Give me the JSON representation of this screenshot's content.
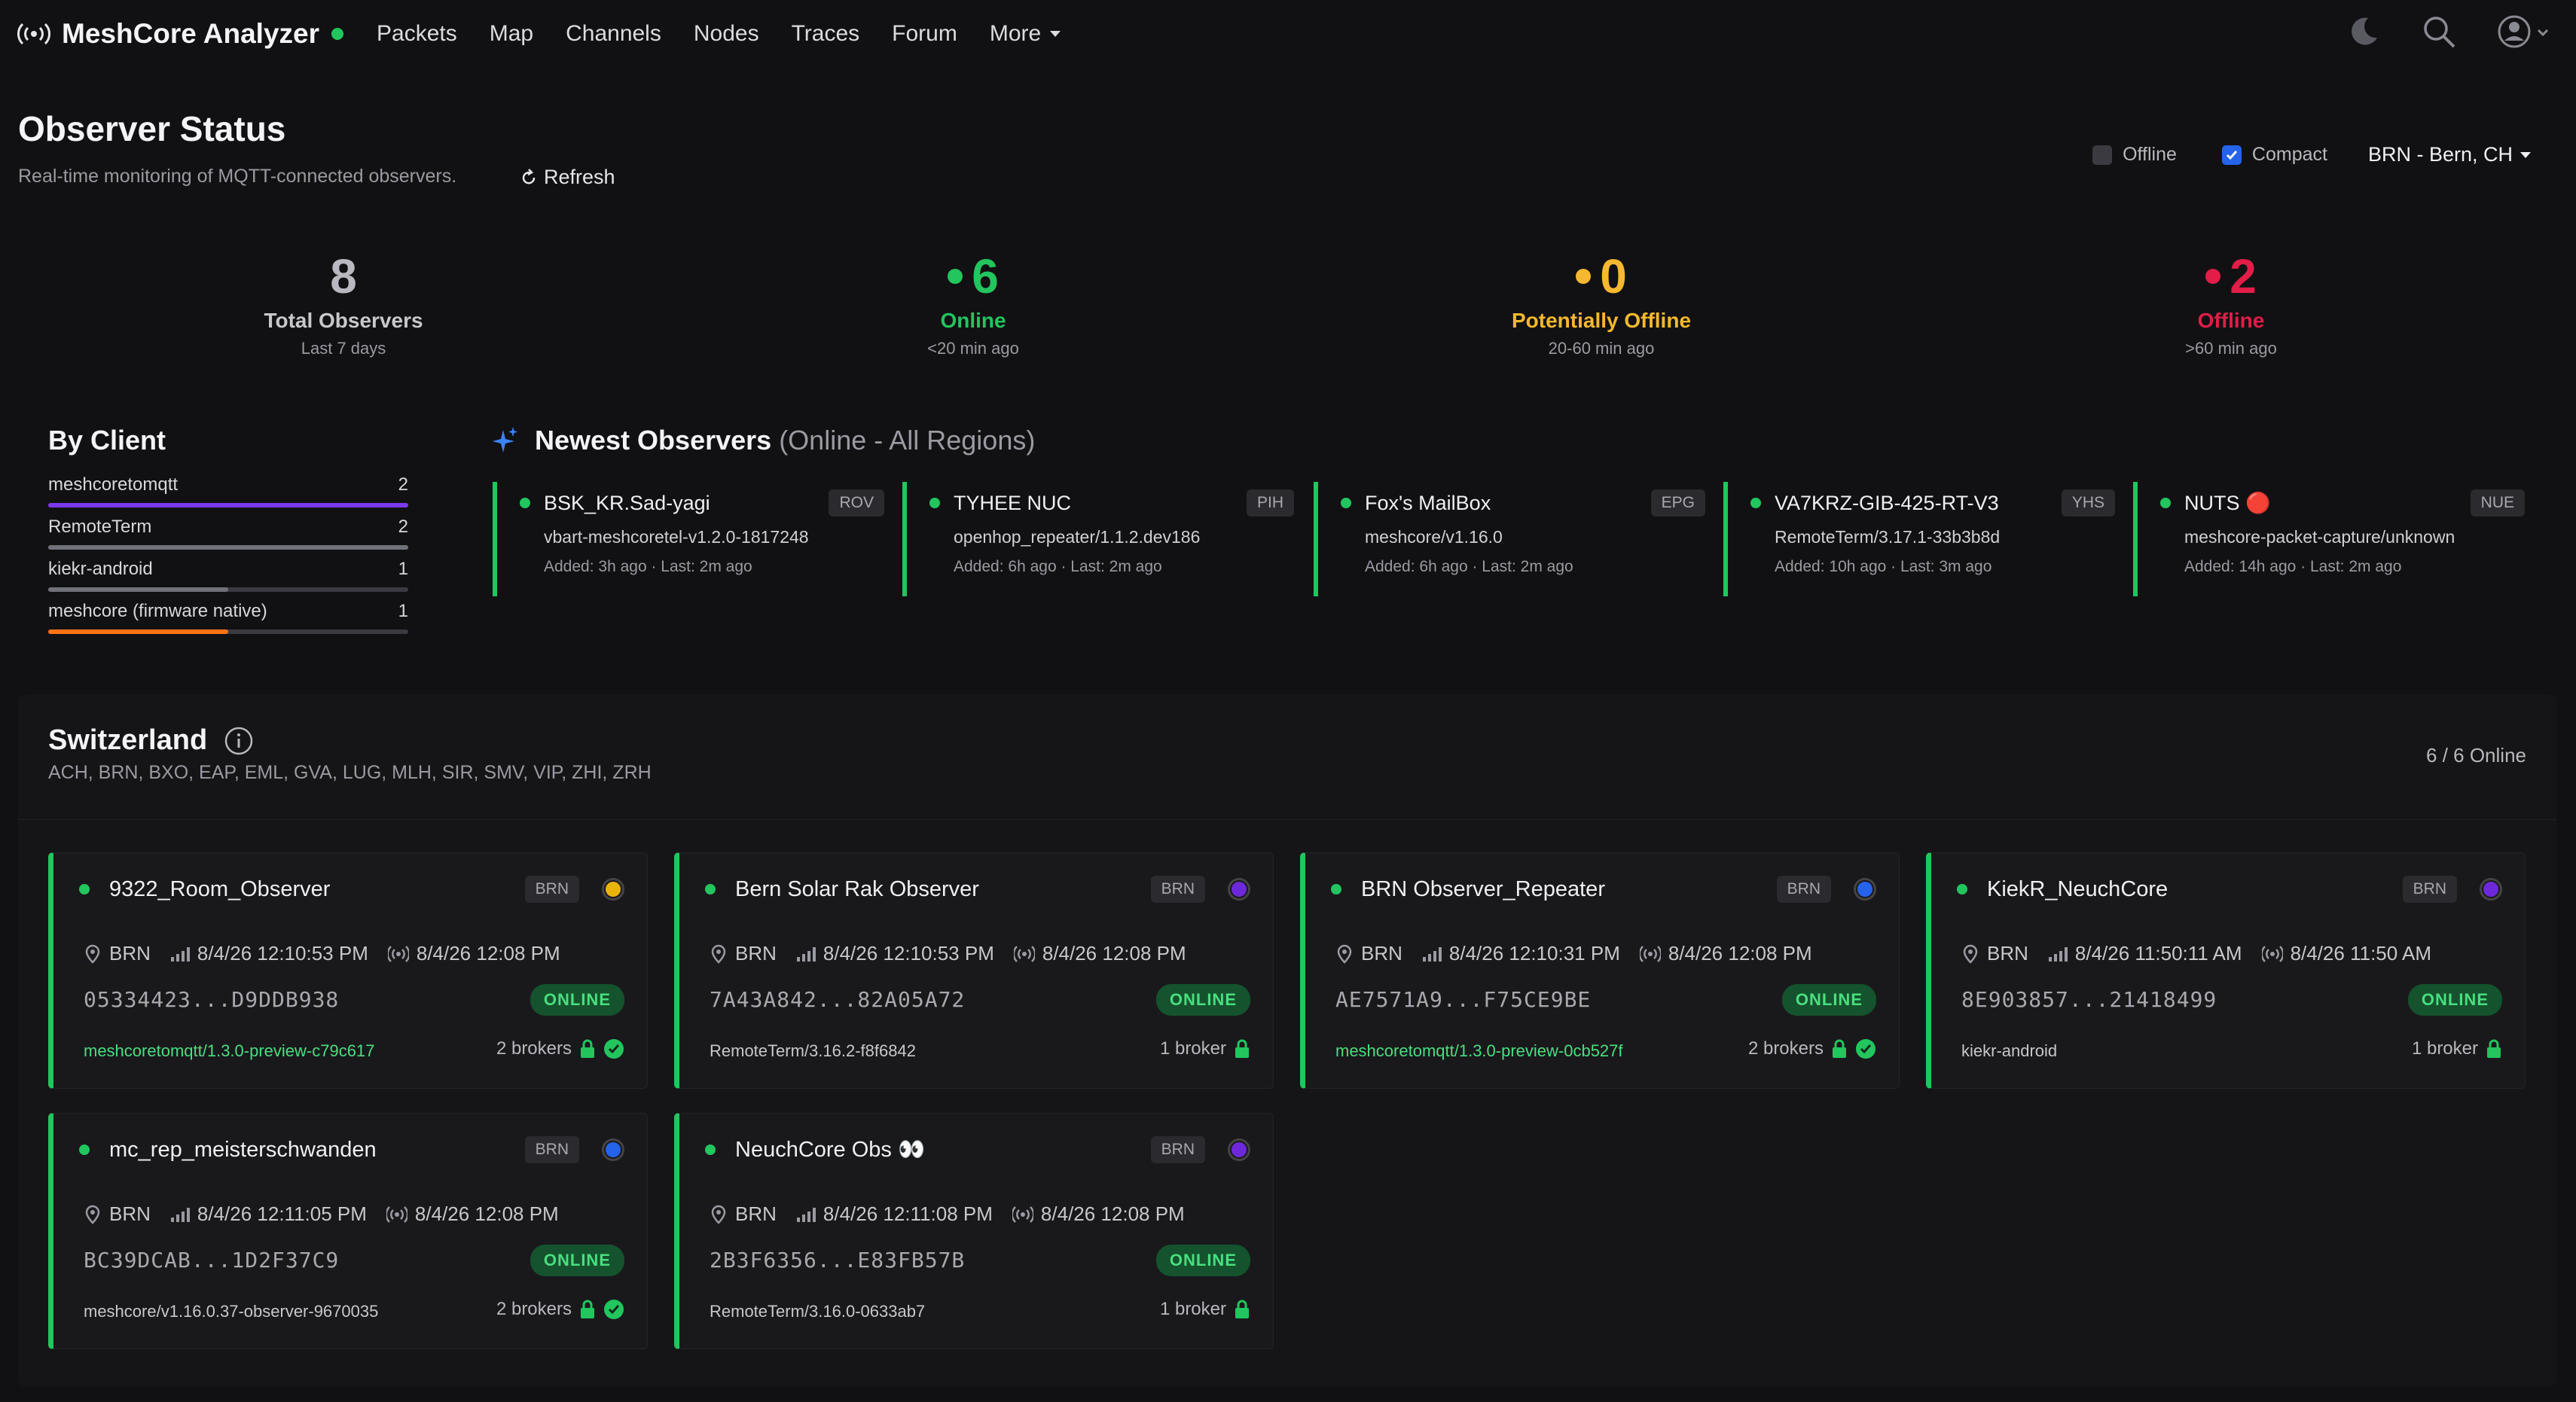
{
  "nav": {
    "brand": "MeshCore Analyzer",
    "links": [
      "Packets",
      "Map",
      "Channels",
      "Nodes",
      "Traces",
      "Forum"
    ],
    "more": "More",
    "icons": [
      "moon-icon",
      "search-icon",
      "user-icon"
    ]
  },
  "header": {
    "title": "Observer Status",
    "subtitle": "Real-time monitoring of MQTT-connected observers.",
    "refresh": "Refresh",
    "filter_offline": "Offline",
    "filter_compact": "Compact",
    "region": "BRN - Bern, CH"
  },
  "stats": [
    {
      "value": "8",
      "label": "Total Observers",
      "sub": "Last 7 days",
      "color": "#9a9aa2"
    },
    {
      "value": "6",
      "label": "Online",
      "sub": "<20 min ago",
      "color": "#22c55e"
    },
    {
      "value": "0",
      "label": "Potentially Offline",
      "sub": "20-60 min ago",
      "color": "#f5b82e"
    },
    {
      "value": "2",
      "label": "Offline",
      "sub": ">60 min ago",
      "color": "#e11d48"
    }
  ],
  "by_client": {
    "title": "By Client",
    "items": [
      {
        "name": "meshcoretomqtt",
        "count": "2",
        "fraction": 1.0,
        "color": "#7c3aed"
      },
      {
        "name": "RemoteTerm",
        "count": "2",
        "fraction": 1.0,
        "color": "#71717a"
      },
      {
        "name": "kiekr-android",
        "count": "1",
        "fraction": 0.5,
        "color": "#71717a"
      },
      {
        "name": "meshcore (firmware native)",
        "count": "1",
        "fraction": 0.5,
        "color": "#f97316"
      }
    ]
  },
  "newest": {
    "title": "Newest Observers",
    "scope": "(Online - All Regions)",
    "items": [
      {
        "name": "BSK_KR.Sad-yagi",
        "tag": "ROV",
        "version": "vbart-meshcoretel-v1.2.0-1817248",
        "added": "Added: 3h ago · Last: 2m ago"
      },
      {
        "name": "TYHEE NUC",
        "tag": "PIH",
        "version": "openhop_repeater/1.1.2.dev186",
        "added": "Added: 6h ago · Last: 2m ago"
      },
      {
        "name": "Fox's MailBox",
        "tag": "EPG",
        "version": "meshcore/v1.16.0",
        "added": "Added: 6h ago · Last: 2m ago"
      },
      {
        "name": "VA7KRZ-GIB-425-RT-V3",
        "tag": "YHS",
        "version": "RemoteTerm/3.17.1-33b3b8d",
        "added": "Added: 10h ago · Last: 3m ago"
      },
      {
        "name": "NUTS 🔴",
        "tag": "NUE",
        "version": "meshcore-packet-capture/unknown",
        "added": "Added: 14h ago · Last: 2m ago"
      }
    ]
  },
  "region": {
    "name": "Switzerland",
    "codes": "ACH, BRN, BXO, EAP, EML, GVA, LUG, MLH, SIR, SMV, VIP, ZHI, ZRH",
    "online": "6 / 6 Online",
    "observers": [
      {
        "name": "9322_Room_Observer",
        "tag": "BRN",
        "ring": "#eab308",
        "loc": "BRN",
        "signal": "8/4/26 12:10:53 PM",
        "radio": "8/4/26 12:08 PM",
        "key": "05334423...D9DDB938",
        "status": "ONLINE",
        "version": "meshcoretomqtt/1.3.0-preview-c79c617",
        "green": true,
        "brokers": "2 brokers",
        "check": true
      },
      {
        "name": "Bern Solar Rak Observer",
        "tag": "BRN",
        "ring": "#6d28d9",
        "loc": "BRN",
        "signal": "8/4/26 12:10:53 PM",
        "radio": "8/4/26 12:08 PM",
        "key": "7A43A842...82A05A72",
        "status": "ONLINE",
        "version": "RemoteTerm/3.16.2-f8f6842",
        "green": false,
        "brokers": "1 broker",
        "check": false
      },
      {
        "name": "BRN Observer_Repeater",
        "tag": "BRN",
        "ring": "#2563eb",
        "loc": "BRN",
        "signal": "8/4/26 12:10:31 PM",
        "radio": "8/4/26 12:08 PM",
        "key": "AE7571A9...F75CE9BE",
        "status": "ONLINE",
        "version": "meshcoretomqtt/1.3.0-preview-0cb527f",
        "green": true,
        "brokers": "2 brokers",
        "check": true
      },
      {
        "name": "KiekR_NeuchCore",
        "tag": "BRN",
        "ring": "#6d28d9",
        "loc": "BRN",
        "signal": "8/4/26 11:50:11 AM",
        "radio": "8/4/26 11:50 AM",
        "key": "8E903857...21418499",
        "status": "ONLINE",
        "version": "kiekr-android",
        "green": false,
        "brokers": "1 broker",
        "check": false
      },
      {
        "name": "mc_rep_meisterschwanden",
        "tag": "BRN",
        "ring": "#2563eb",
        "loc": "BRN",
        "signal": "8/4/26 12:11:05 PM",
        "radio": "8/4/26 12:08 PM",
        "key": "BC39DCAB...1D2F37C9",
        "status": "ONLINE",
        "version": "meshcore/v1.16.0.37-observer-9670035",
        "green": false,
        "brokers": "2 brokers",
        "check": true
      },
      {
        "name": "NeuchCore Obs 👀",
        "tag": "BRN",
        "ring": "#6d28d9",
        "loc": "BRN",
        "signal": "8/4/26 12:11:08 PM",
        "radio": "8/4/26 12:08 PM",
        "key": "2B3F6356...E83FB57B",
        "status": "ONLINE",
        "version": "RemoteTerm/3.16.0-0633ab7",
        "green": false,
        "brokers": "1 broker",
        "check": false
      }
    ]
  }
}
